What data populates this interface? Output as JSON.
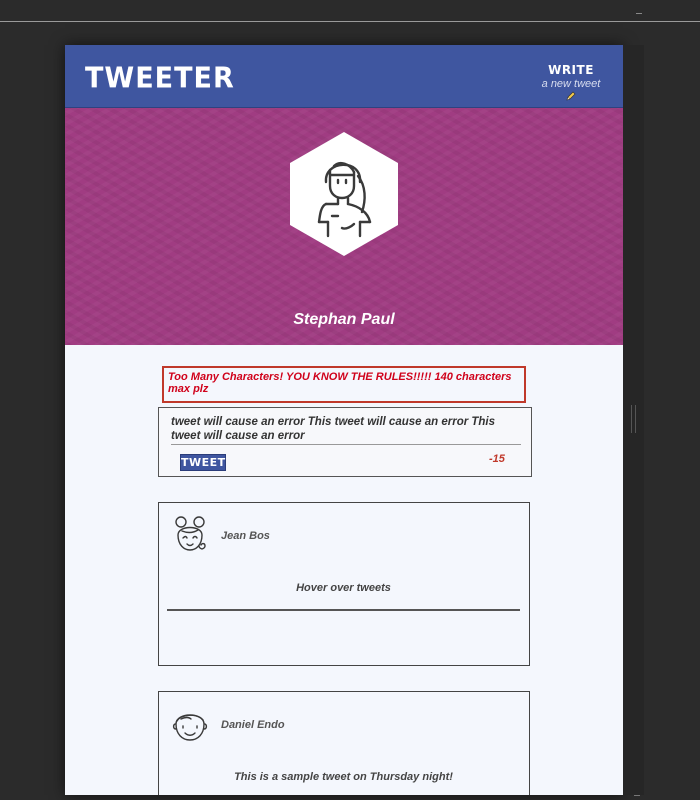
{
  "nav": {
    "logo": "TWEETER",
    "write_title": "WRITE",
    "write_subtitle": "a new tweet"
  },
  "profile": {
    "name": "Stephan Paul",
    "banner_color": "#a03c82"
  },
  "compose": {
    "error_message": "Too Many Characters! YOU KNOW THE RULES!!!!! 140 characters max plz",
    "text": "tweet will cause an error This tweet will cause an error This tweet will cause an error",
    "button_label": "TWEET",
    "char_count": "-15"
  },
  "tweets": [
    {
      "author": "Jean Bos",
      "body": "Hover over tweets"
    },
    {
      "author": "Daniel Endo",
      "body": "This is a sample tweet on Thursday night!"
    }
  ],
  "colors": {
    "accent": "#3f56a0",
    "error": "#d0021b",
    "background": "#f4f7fd"
  },
  "icons": {
    "profile_avatar": "female-avatar-icon",
    "write": "pencil-icon"
  }
}
